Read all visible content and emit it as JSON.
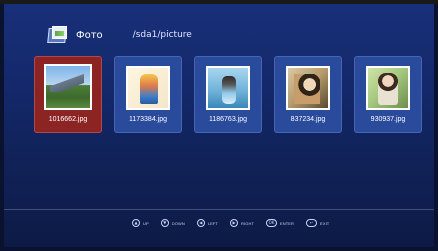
{
  "header": {
    "title": "Фото",
    "path": "/sda1/picture",
    "icon": "photo-folder-icon"
  },
  "photos": [
    {
      "filename": "1016662.jpg",
      "selected": true
    },
    {
      "filename": "1173384.jpg",
      "selected": false
    },
    {
      "filename": "1186763.jpg",
      "selected": false
    },
    {
      "filename": "837234.jpg",
      "selected": false
    },
    {
      "filename": "930937.jpg",
      "selected": false
    }
  ],
  "footer": {
    "hints": [
      {
        "key": "up",
        "label": "UP",
        "icon": "up-arrow-icon"
      },
      {
        "key": "down",
        "label": "DOWN",
        "icon": "down-arrow-icon"
      },
      {
        "key": "left",
        "label": "LEFT",
        "icon": "left-arrow-icon"
      },
      {
        "key": "right",
        "label": "RIGHT",
        "icon": "right-arrow-icon"
      },
      {
        "key": "enter",
        "label": "ENTER",
        "icon": "ok-icon"
      },
      {
        "key": "exit",
        "label": "EXIT",
        "icon": "exit-icon"
      }
    ]
  },
  "colors": {
    "background": "#14286a",
    "card": "#2a4a9c",
    "selected_card": "#8d2424",
    "text": "#ffffff"
  }
}
